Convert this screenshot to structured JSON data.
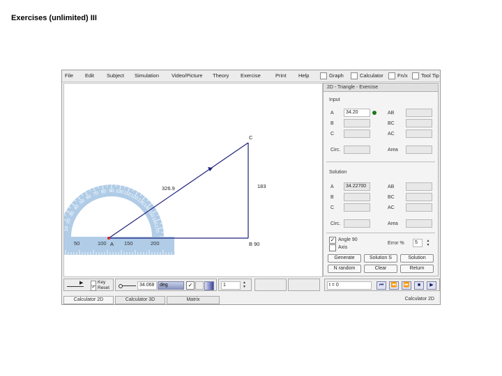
{
  "slide_title": "Exercises (unlimited) III",
  "menu": {
    "items": [
      "File",
      "Edit",
      "Subject",
      "Simulation",
      "Video/Picture",
      "Theory",
      "Exercise",
      "Print",
      "Help"
    ],
    "toggles": [
      "Graph",
      "Calculator",
      "Fn/x",
      "Tool Tip"
    ]
  },
  "canvas": {
    "vertex_c": "C",
    "vertex_b_line": "B  90",
    "vertex_a": "A",
    "hypotenuse_value": "326.9",
    "vertical_value": "183",
    "protractor_scale": [
      "50",
      "100",
      "150",
      "200"
    ],
    "protractor_numbers": [
      "10",
      "20",
      "30",
      "40",
      "50",
      "60",
      "70",
      "80",
      "90",
      "100",
      "110",
      "120",
      "130",
      "140",
      "150",
      "160",
      "170"
    ]
  },
  "panel": {
    "title": "2D - Triangle - Exercise",
    "input_heading": "Input",
    "input_labels": {
      "a": "A",
      "b": "B",
      "c": "C",
      "ab": "AB",
      "bc": "BC",
      "ac": "AC",
      "circ": "Circ.",
      "area": "Area"
    },
    "input_a_value": "34.20",
    "solution_heading": "Solution",
    "solution_labels": {
      "a": "A",
      "b": "B",
      "c": "C",
      "ab": "AB",
      "bc": "BC",
      "ac": "AC",
      "circ": "Circ.",
      "area": "Area"
    },
    "solution_a_value": "34.22700",
    "angle_label": "Angle 90",
    "axis_label": "Axis",
    "error_label": "Error %",
    "error_value": "5",
    "buttons": {
      "generate": "Generate",
      "solution_s": "Solution S",
      "solution": "Solution",
      "n_random": "N random",
      "clear": "Clear",
      "return": "Return"
    }
  },
  "bottom": {
    "key_label": "Key",
    "reset_label": "Reset",
    "angle_value": "34.068",
    "angle_unit": "deg",
    "step_value": "1",
    "time_value": "t = 0"
  },
  "tabs": [
    "Calculator 2D",
    "Calculator 3D",
    "Matrix"
  ],
  "status_right": "Calculator 2D",
  "colors": {
    "line": "#1c1f7a",
    "protractor": "#a7c7e4",
    "point": "#e0201e",
    "solution_dot": "#1a7a1a"
  }
}
